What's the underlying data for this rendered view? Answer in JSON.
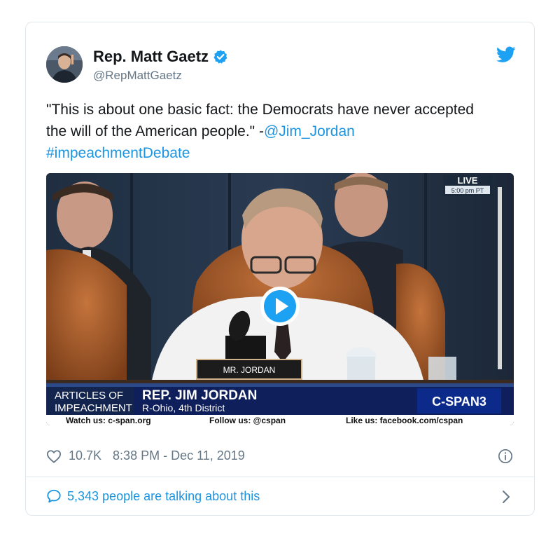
{
  "author": {
    "name": "Rep. Matt Gaetz",
    "handle": "@RepMattGaetz"
  },
  "tweet": {
    "text_main": "\"This is about one basic fact: the Democrats have never accepted the will of the American people.\" -",
    "mention": "@Jim_Jordan",
    "hashtag": "#impeachmentDebate"
  },
  "video": {
    "live_label": "LIVE",
    "live_time": "5:00 pm PT",
    "nameplate": "MR. JORDAN",
    "chyron_topic_line1": "ARTICLES OF",
    "chyron_topic_line2": "IMPEACHMENT",
    "chyron_name": "REP. JIM JORDAN",
    "chyron_district": "R-Ohio, 4th District",
    "network": "C-SPAN3",
    "footer_watch": "Watch us: c-span.org",
    "footer_follow": "Follow us: @cspan",
    "footer_like": "Like us: facebook.com/cspan"
  },
  "meta": {
    "likes": "10.7K",
    "timestamp": "8:38 PM - Dec 11, 2019"
  },
  "footer": {
    "talking": "5,343 people are talking about this"
  },
  "icons": [
    "verified-badge-icon",
    "twitter-bird-icon",
    "play-icon",
    "heart-icon",
    "info-icon",
    "comment-bubble-icon",
    "chevron-right-icon"
  ],
  "colors": {
    "accent": "#1da1f2",
    "link": "#1b95e0",
    "muted": "#657786"
  }
}
